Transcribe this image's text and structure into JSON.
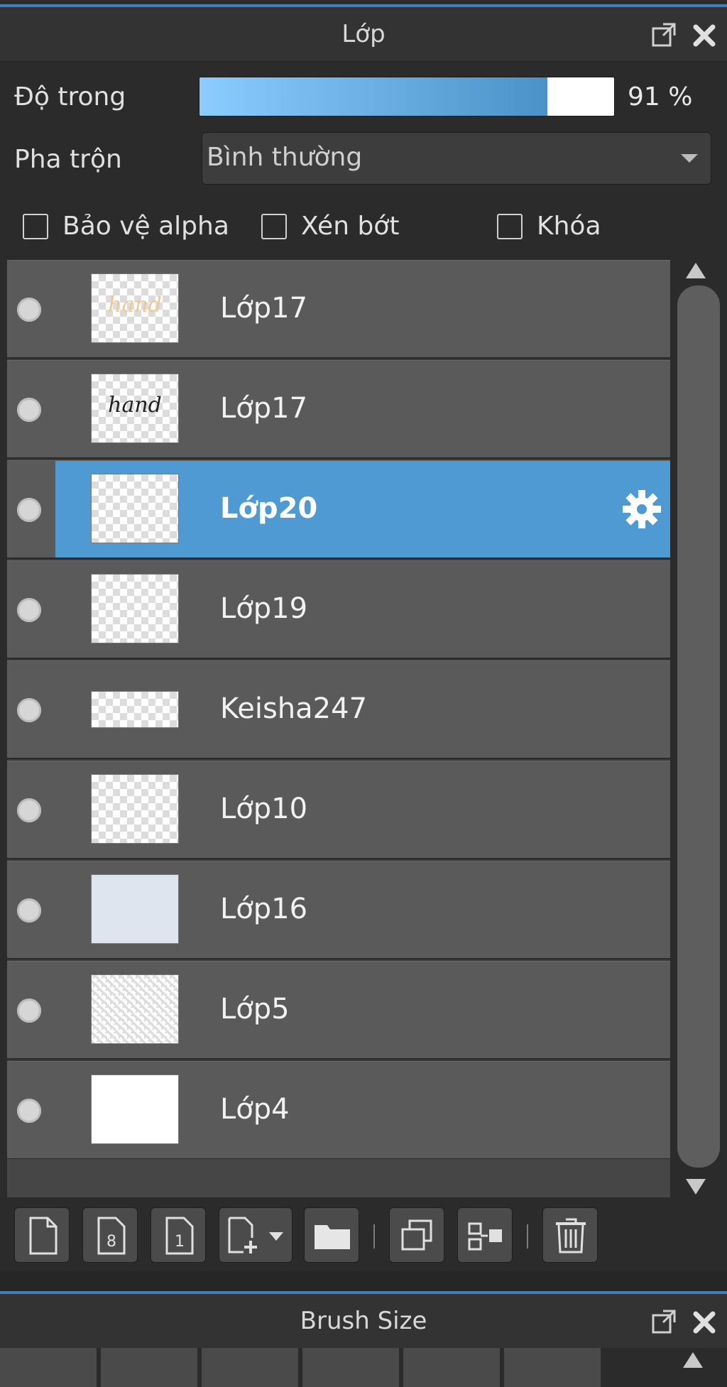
{
  "panel": {
    "title": "Lớp",
    "opacity_label": "Độ trong",
    "opacity_value": "91 %",
    "opacity_fraction": 0.91,
    "blend_label": "Pha trộn",
    "blend_value": "Bình thường",
    "checkboxes": [
      {
        "label": "Bảo vệ alpha",
        "checked": false
      },
      {
        "label": "Xén bớt",
        "checked": false
      },
      {
        "label": "Khóa",
        "checked": false
      }
    ]
  },
  "layers": [
    {
      "name": "Lớp17",
      "thumb": "hand-orange",
      "selected": false
    },
    {
      "name": "Lớp17",
      "thumb": "hand-black",
      "selected": false
    },
    {
      "name": "Lớp20",
      "thumb": "transparent",
      "selected": true
    },
    {
      "name": "Lớp19",
      "thumb": "transparent",
      "selected": false
    },
    {
      "name": "Keisha247",
      "thumb": "transparent-short",
      "selected": false
    },
    {
      "name": "Lớp10",
      "thumb": "transparent",
      "selected": false
    },
    {
      "name": "Lớp16",
      "thumb": "plain-blue",
      "selected": false
    },
    {
      "name": "Lớp5",
      "thumb": "grid",
      "selected": false
    },
    {
      "name": "Lớp4",
      "thumb": "plain-white",
      "selected": false
    }
  ],
  "thumb_art": {
    "hand_orange": "hand",
    "hand_black": "hand"
  },
  "toolbar": {
    "buttons": [
      "new-layer-icon",
      "new-8bit-layer-icon",
      "new-1bit-layer-icon",
      "add-layer-dropdown-icon",
      "new-folder-icon",
      "duplicate-layer-icon",
      "merge-layer-icon",
      "delete-layer-icon"
    ],
    "page_8": "8",
    "page_1": "1"
  },
  "brush_panel": {
    "title": "Brush Size"
  },
  "colors": {
    "accent": "#4f9ad3",
    "panel_bg": "#2b2b2b",
    "layer_bg": "#5a5a5a"
  }
}
